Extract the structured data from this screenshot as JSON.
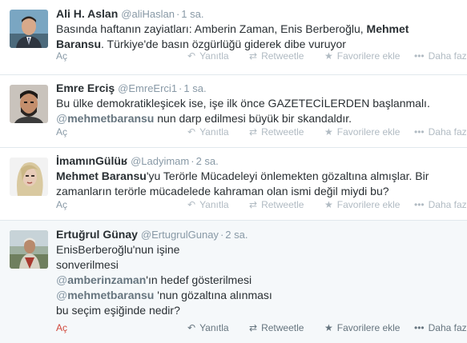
{
  "tweets": [
    {
      "fullname": "Ali H. Aslan",
      "username": "@aliHaslan",
      "dot": "·",
      "time": "1 sa.",
      "avatar_icon": "avatar-man-suit",
      "lines": [
        {
          "parts": [
            "Basında haftanın zayiatları: Amberin Zaman, Enis Berberoğlu, ",
            "Mehmet"
          ]
        },
        {
          "parts": [
            "Baransu",
            ". Türkiye'de basın özgürlüğü giderek dibe vuruyor"
          ]
        }
      ],
      "expand": "Aç"
    },
    {
      "fullname": "Emre Erciş",
      "username": "@EmreErci1",
      "dot": "·",
      "time": "1 sa.",
      "avatar_icon": "avatar-bearded-man",
      "lines": [
        {
          "parts": [
            "Bu ülke demokratikleşicek ise, işe ilk önce GAZETECİLERDEN başlanmalı."
          ]
        },
        {
          "parts": [
            "@",
            "mehmetbaransu",
            " nun darp edilmesi büyük bir skandaldır."
          ]
        }
      ],
      "expand": "Aç"
    },
    {
      "fullname": "İmamınGülüʁ",
      "username": "@Ladyimam",
      "dot": "·",
      "time": "2 sa.",
      "avatar_icon": "avatar-woman-blonde",
      "lines": [
        {
          "parts": [
            "Mehmet Baransu",
            "'yu Terörle Mücadeleyi önlemekten gözaltına almışlar. Bir"
          ]
        },
        {
          "parts": [
            "zamanların terörle mücadelede kahraman olan ismi değil miydi bu?"
          ]
        }
      ],
      "expand": "Aç"
    },
    {
      "fullname": "Ertuğrul Günay",
      "username": "@ErtugrulGunay",
      "dot": "·",
      "time": "2 sa.",
      "avatar_icon": "avatar-man-outdoor",
      "lines": [
        {
          "parts": [
            "EnisBerberoğlu'nun işine"
          ]
        },
        {
          "parts": [
            "sonverilmesi"
          ]
        },
        {
          "parts": [
            "@",
            "amberinzaman",
            "'ın hedef gösterilmesi"
          ]
        },
        {
          "parts": [
            "@",
            "mehmetbaransu",
            " 'nun gözaltına alınması"
          ]
        },
        {
          "parts": [
            "bu seçim eşiğinde nedir?"
          ]
        }
      ],
      "expand": "Aç"
    }
  ],
  "actions": {
    "reply": "Yanıtla",
    "retweet": "Retweetle",
    "favorite": "Favorilere ekle",
    "more": "Daha fazla"
  },
  "icons": {
    "reply": "reply-icon",
    "retweet": "retweet-icon",
    "favorite": "star-icon",
    "more": "more-dots-icon"
  },
  "colors": {
    "link_gray": "#66757f",
    "meta_gray": "#8899a6",
    "expand_red": "#d0473a",
    "highlight_bg": "#f5f8fa"
  }
}
